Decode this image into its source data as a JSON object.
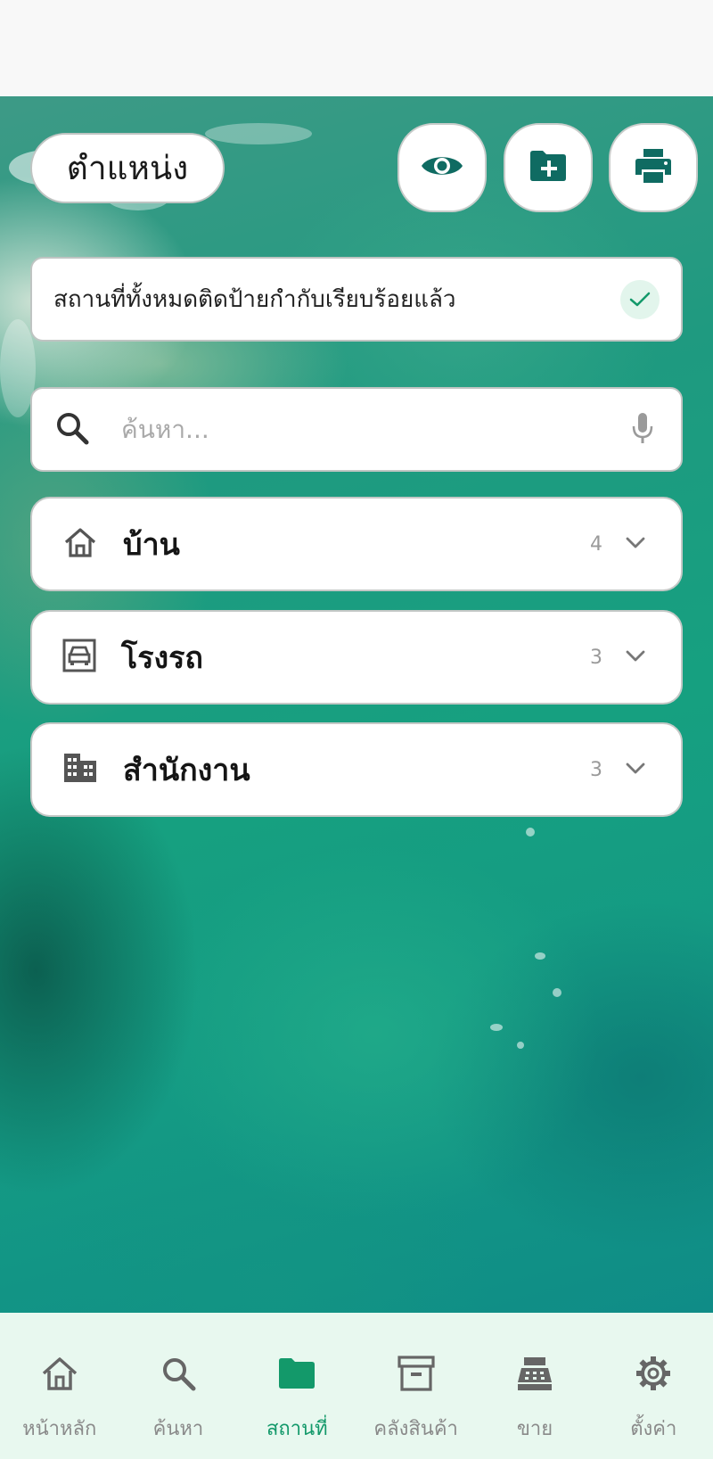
{
  "header": {
    "title": "ตำแหน่ง",
    "actions": [
      {
        "name": "view",
        "icon": "eye-icon"
      },
      {
        "name": "add-folder",
        "icon": "folder-plus-icon"
      },
      {
        "name": "print",
        "icon": "printer-icon"
      }
    ]
  },
  "status": {
    "text": "สถานที่ทั้งหมดติดป้ายกำกับเรียบร้อยแล้ว",
    "icon": "check-icon"
  },
  "search": {
    "placeholder": "ค้นหา...",
    "value": ""
  },
  "locations": [
    {
      "label": "บ้าน",
      "count": "4",
      "icon": "home-icon"
    },
    {
      "label": "โรงรถ",
      "count": "3",
      "icon": "garage-icon"
    },
    {
      "label": "สำนักงาน",
      "count": "3",
      "icon": "building-icon"
    }
  ],
  "nav": {
    "items": [
      {
        "label": "หน้าหลัก",
        "icon": "home-icon",
        "active": false
      },
      {
        "label": "ค้นหา",
        "icon": "search-icon",
        "active": false
      },
      {
        "label": "สถานที่",
        "icon": "folder-icon",
        "active": true
      },
      {
        "label": "คลังสินค้า",
        "icon": "archive-icon",
        "active": false
      },
      {
        "label": "ขาย",
        "icon": "cash-register-icon",
        "active": false
      },
      {
        "label": "ตั้งค่า",
        "icon": "gear-icon",
        "active": false
      }
    ]
  },
  "colors": {
    "accent": "#13996a",
    "icon_dark_teal": "#0f6b62",
    "nav_background": "#e8f8ef"
  }
}
